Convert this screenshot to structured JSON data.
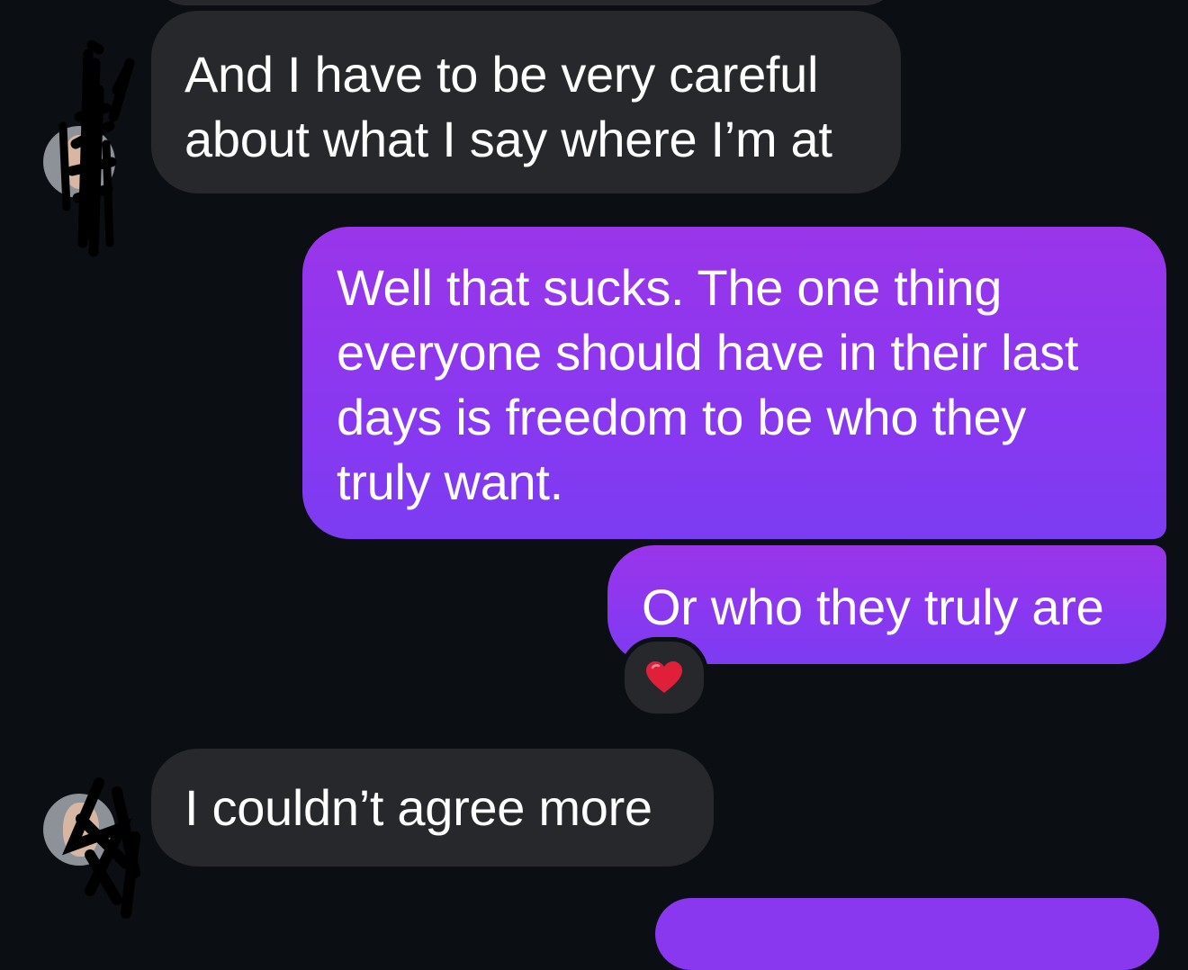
{
  "conversation": {
    "messages": [
      {
        "direction": "incoming",
        "text": "And I have to be very careful\nabout what I say where I’m at"
      },
      {
        "direction": "outgoing",
        "text": "Well that sucks. The one thing\neveryone should have in their last\ndays is freedom to be who they\ntruly want."
      },
      {
        "direction": "outgoing",
        "text": "Or who they truly are",
        "reaction": "heart-icon"
      },
      {
        "direction": "incoming",
        "text": "I couldn’t agree more"
      }
    ]
  },
  "colors": {
    "background": "#0b0e12",
    "incoming_bubble": "#26282c",
    "outgoing_bubble": "#8a38f0",
    "heart": "#e0203a"
  }
}
